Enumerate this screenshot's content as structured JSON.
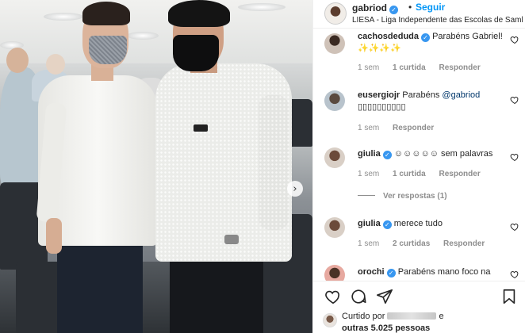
{
  "header": {
    "username": "gabriod",
    "separator": "•",
    "follow_label": "Seguir",
    "location": "LIESA - Liga Independente das Escolas de Samba"
  },
  "carousel": {
    "next_icon": "›"
  },
  "comments": [
    {
      "user": "cachosdeduda",
      "text": "Parabéns Gabriel! ✨✨✨✨",
      "time": "1 sem",
      "likes": "1 curtida",
      "reply": "Responder"
    },
    {
      "user": "eusergiojr",
      "text_pre": "Parabéns ",
      "mention": "@gabriod",
      "text_post": " ▯▯▯▯▯▯▯▯▯▯",
      "time": "1 sem",
      "reply": "Responder"
    },
    {
      "user": "giulia",
      "text": "☺☺☺☺☺ sem palavras",
      "time": "1 sem",
      "likes": "1 curtida",
      "reply": "Responder",
      "view_replies": "Ver respostas (1)"
    },
    {
      "user": "giulia",
      "text": "merece tudo",
      "time": "1 sem",
      "likes": "2 curtidas",
      "reply": "Responder"
    },
    {
      "user": "orochi",
      "text": "Parabéns mano foco na"
    }
  ],
  "footer": {
    "liked_prefix": "Curtido por",
    "liked_mid": "e",
    "liked_others": "outras 5.025 pessoas"
  },
  "colors": {
    "accent": "#0095f6",
    "verified": "#3897f0",
    "muted": "#8e8e8e"
  }
}
